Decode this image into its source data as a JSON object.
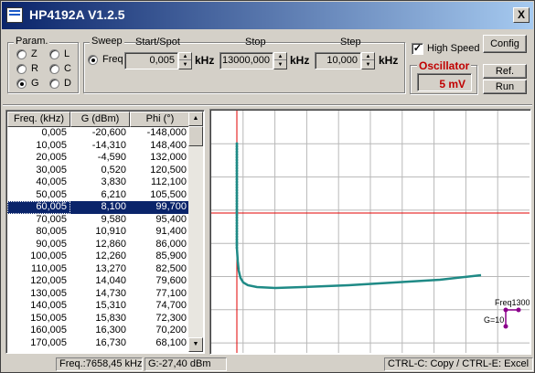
{
  "window": {
    "title": "HP4192A V1.2.5",
    "close_label": "X"
  },
  "param": {
    "group_label": "Param.",
    "options": [
      {
        "label": "Z",
        "selected": false
      },
      {
        "label": "L",
        "selected": false
      },
      {
        "label": "R",
        "selected": false
      },
      {
        "label": "C",
        "selected": false
      },
      {
        "label": "G",
        "selected": true
      },
      {
        "label": "D",
        "selected": false
      }
    ]
  },
  "sweep": {
    "group_label": "Sweep",
    "freq_label": "Freq",
    "freq_selected": true,
    "start_label": "Start/Spot",
    "stop_label": "Stop",
    "step_label": "Step",
    "start_value": "0,005",
    "stop_value": "13000,000",
    "step_value": "10,000",
    "unit": "kHz"
  },
  "high_speed": {
    "label": "High Speed",
    "checked": true,
    "check_glyph": "✓"
  },
  "oscillator": {
    "label": "Oscillator",
    "value": "5 mV"
  },
  "buttons": {
    "config": "Config",
    "ref": "Ref.",
    "run": "Run"
  },
  "table": {
    "headers": [
      "Freq. (kHz)",
      "G (dBm)",
      "Phi (°)"
    ],
    "selected_index": 6,
    "rows": [
      [
        "0,005",
        "-20,600",
        "-148,000"
      ],
      [
        "10,005",
        "-14,310",
        "148,400"
      ],
      [
        "20,005",
        "-4,590",
        "132,000"
      ],
      [
        "30,005",
        "0,520",
        "120,500"
      ],
      [
        "40,005",
        "3,830",
        "112,100"
      ],
      [
        "50,005",
        "6,210",
        "105,500"
      ],
      [
        "60,005",
        "8,100",
        "99,700"
      ],
      [
        "70,005",
        "9,580",
        "95,400"
      ],
      [
        "80,005",
        "10,910",
        "91,400"
      ],
      [
        "90,005",
        "12,860",
        "86,000"
      ],
      [
        "100,005",
        "12,260",
        "85,900"
      ],
      [
        "110,005",
        "13,270",
        "82,500"
      ],
      [
        "120,005",
        "14,040",
        "79,600"
      ],
      [
        "130,005",
        "14,730",
        "77,100"
      ],
      [
        "140,005",
        "15,310",
        "74,700"
      ],
      [
        "150,005",
        "15,830",
        "72,300"
      ],
      [
        "160,005",
        "16,300",
        "70,200"
      ],
      [
        "170,005",
        "16,730",
        "68,100"
      ]
    ]
  },
  "plot": {
    "trace_color": "#1f8a86",
    "cursor_color": "#e00000",
    "marker_color": "#8b008b",
    "marker_freq_label": "Freq1300",
    "marker_g_label": "G=10"
  },
  "status": {
    "freq": "Freq.:7658,45 kHz",
    "g": "G:-27,40 dBm",
    "hint": "CTRL-C: Copy / CTRL-E: Excel"
  }
}
